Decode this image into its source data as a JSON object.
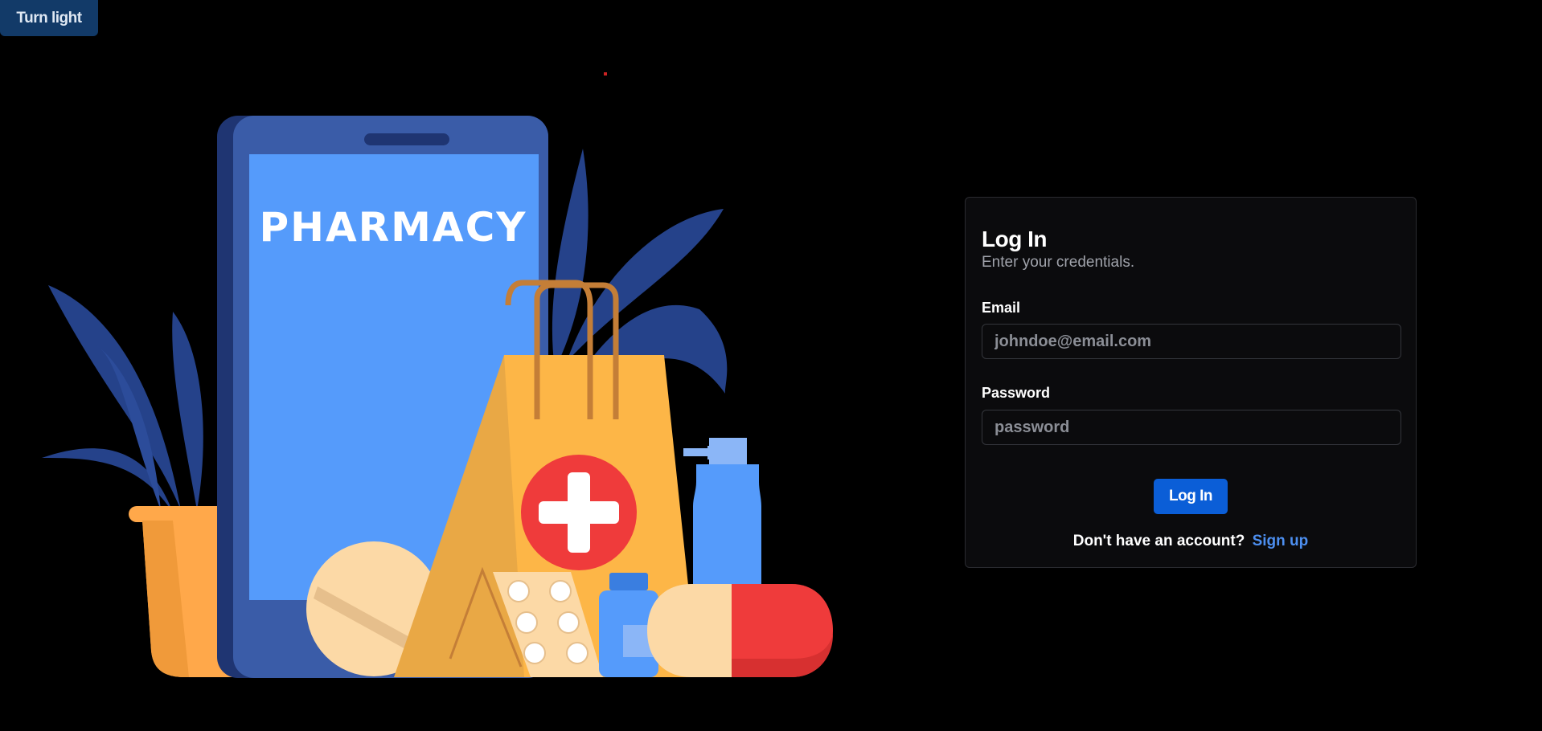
{
  "theme_toggle": {
    "label": "Turn light"
  },
  "illustration": {
    "phone_text": "PHARMACY"
  },
  "login": {
    "title": "Log In",
    "subtitle": "Enter your credentials.",
    "email_label": "Email",
    "email_placeholder": "johndoe@email.com",
    "password_label": "Password",
    "password_placeholder": "password",
    "submit_label": "Log In",
    "signup_prompt": "Don't have an account?",
    "signup_link": "Sign up"
  },
  "colors": {
    "background": "#000000",
    "accent": "#0b5ed7",
    "link": "#4d8ff0",
    "theme_button": "#123a68"
  }
}
